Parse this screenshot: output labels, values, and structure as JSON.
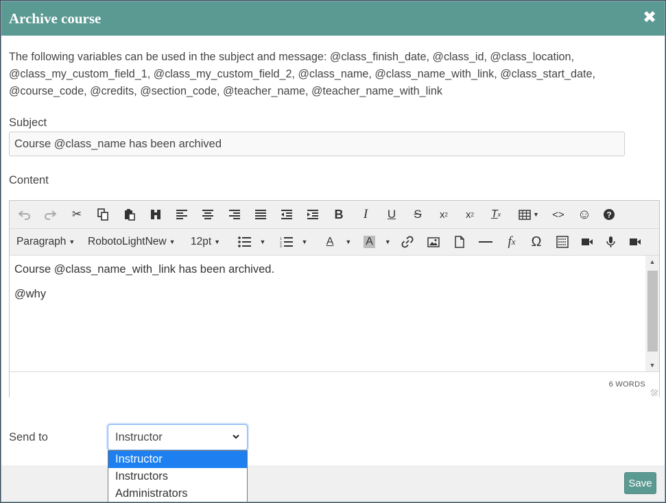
{
  "dialog": {
    "title": "Archive course",
    "close_icon": "close-icon"
  },
  "variables_text": "The following variables can be used in the subject and message: @class_finish_date, @class_id, @class_location, @class_my_custom_field_1, @class_my_custom_field_2, @class_name, @class_name_with_link, @class_start_date, @course_code, @credits, @section_code, @teacher_name, @teacher_name_with_link",
  "subject": {
    "label": "Subject",
    "value": "Course @class_name has been archived"
  },
  "content": {
    "label": "Content",
    "toolbar_row1": [
      "undo-icon",
      "redo-icon",
      "cut-icon",
      "copy-icon",
      "paste-icon",
      "find-icon",
      "align-left-icon",
      "align-center-icon",
      "align-right-icon",
      "justify-icon",
      "outdent-icon",
      "indent-icon",
      "bold-icon",
      "italic-icon",
      "underline-icon",
      "strikethrough-icon",
      "subscript-icon",
      "superscript-icon",
      "clear-format-icon",
      "table-icon",
      "code-icon",
      "emoticon-icon",
      "help-icon"
    ],
    "toolbar_row2": {
      "block_format": "Paragraph",
      "font_family": "RobotoLightNew",
      "font_size": "12pt",
      "icons": [
        "bullet-list-icon",
        "numbered-list-icon",
        "text-color-icon",
        "background-color-icon",
        "link-icon",
        "image-icon",
        "document-icon",
        "horizontal-rule-icon",
        "formula-icon",
        "special-char-icon",
        "template-icon",
        "video-icon",
        "audio-icon",
        "media-icon"
      ]
    },
    "lines": [
      "Course @class_name_with_link has been archived.",
      "@why"
    ],
    "word_count": "6 WORDS"
  },
  "send_to": {
    "label": "Send to",
    "selected": "Instructor",
    "options": [
      "Instructor",
      "Instructors",
      "Administrators"
    ]
  },
  "footer": {
    "save_label": "Save"
  },
  "colors": {
    "accent": "#5b9a93",
    "selected_option": "#1e80f0"
  }
}
